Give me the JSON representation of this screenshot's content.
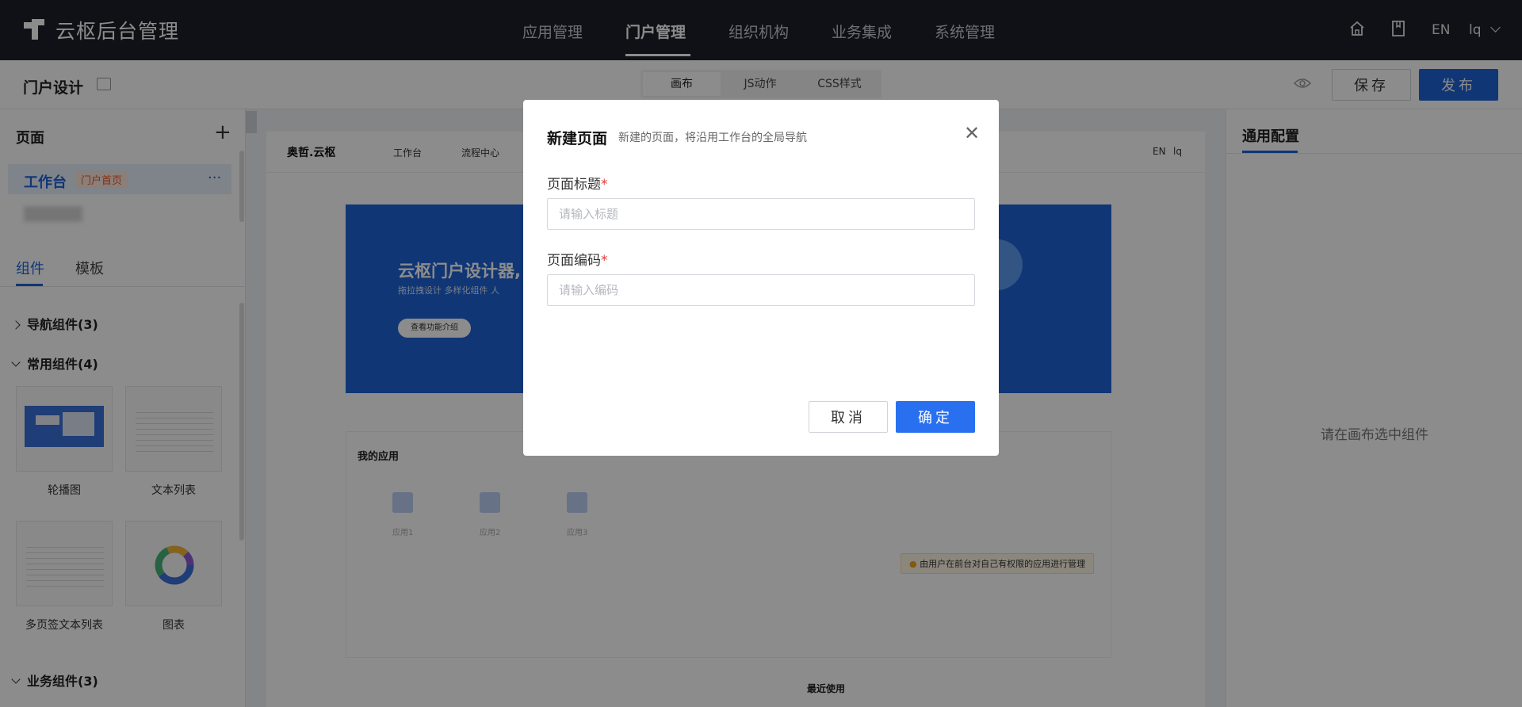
{
  "app": {
    "title": "云枢后台管理"
  },
  "nav": {
    "items": [
      "应用管理",
      "门户管理",
      "组织机构",
      "业务集成",
      "系统管理"
    ],
    "active": "门户管理"
  },
  "top_icons": {
    "home": "home-icon",
    "book": "book-icon",
    "lang": "EN",
    "user": "lq"
  },
  "toolbar": {
    "title": "门户设计",
    "tabs": [
      "画布",
      "JS动作",
      "CSS样式"
    ],
    "active_tab": "画布",
    "save_label": "保存",
    "publish_label": "发布"
  },
  "left": {
    "pages_title": "页面",
    "page": {
      "name": "工作台",
      "tag": "门户首页"
    },
    "tabs": [
      "组件",
      "模板"
    ],
    "groups": {
      "nav": "导航组件(3)",
      "common": "常用组件(4)",
      "business": "业务组件(3)"
    },
    "components": [
      "轮播图",
      "文本列表",
      "多页签文本列表",
      "图表"
    ]
  },
  "canvas": {
    "logo": "奥哲.云枢",
    "nav": [
      "工作台",
      "流程中心"
    ],
    "lang": "EN",
    "user": "lq",
    "banner_title": "云枢门户设计器,",
    "banner_sub": "拖拉拽设计   多样化组件   人",
    "banner_btn": "查看功能介绍",
    "apps_title": "我的应用",
    "apps": [
      "应用1",
      "应用2",
      "应用3"
    ],
    "tip": "由用户在前台对自己有权限的应用进行管理",
    "recent_title": "最近使用"
  },
  "right": {
    "title": "通用配置",
    "empty_text": "请在画布选中组件"
  },
  "modal": {
    "title": "新建页面",
    "desc": "新建的页面，将沿用工作台的全局导航",
    "field1_label": "页面标题",
    "field1_placeholder": "请输入标题",
    "field2_label": "页面编码",
    "field2_placeholder": "请输入编码",
    "required_mark": "*",
    "cancel_label": "取消",
    "ok_label": "确定"
  },
  "colors": {
    "primary": "#1e63d6",
    "nav_bg": "#1d2029",
    "required": "#e23a3a"
  }
}
